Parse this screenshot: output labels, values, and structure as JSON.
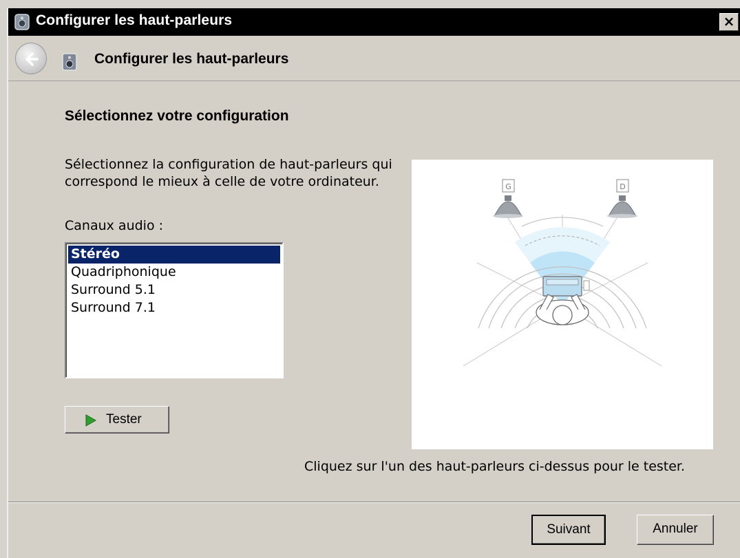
{
  "window": {
    "title": "Configurer les haut-parleurs",
    "close_glyph": "×"
  },
  "nav": {
    "title": "Configurer les haut-parleurs",
    "back_icon": "back-arrow-icon",
    "page_icon": "speaker-icon"
  },
  "main": {
    "heading": "Sélectionnez votre configuration",
    "description": "Sélectionnez la configuration de haut-parleurs qui correspond le mieux à celle de votre ordinateur.",
    "channels_label": "Canaux audio :",
    "channels": [
      {
        "label": "Stéréo",
        "selected": true
      },
      {
        "label": "Quadriphonique",
        "selected": false
      },
      {
        "label": "Surround 5.1",
        "selected": false
      },
      {
        "label": "Surround 7.1",
        "selected": false
      }
    ],
    "test_button": "Tester",
    "hint": "Cliquez sur l'un des haut-parleurs ci-dessus pour le tester."
  },
  "diagram": {
    "left_speaker_label": "G",
    "right_speaker_label": "D"
  },
  "footer": {
    "next_label": "Suivant",
    "cancel_label": "Annuler"
  },
  "colors": {
    "selection": "#0a246a",
    "titlebar": "#000000",
    "play_icon": "#2e9e2e",
    "listening_zone": "#bfe4f8"
  }
}
